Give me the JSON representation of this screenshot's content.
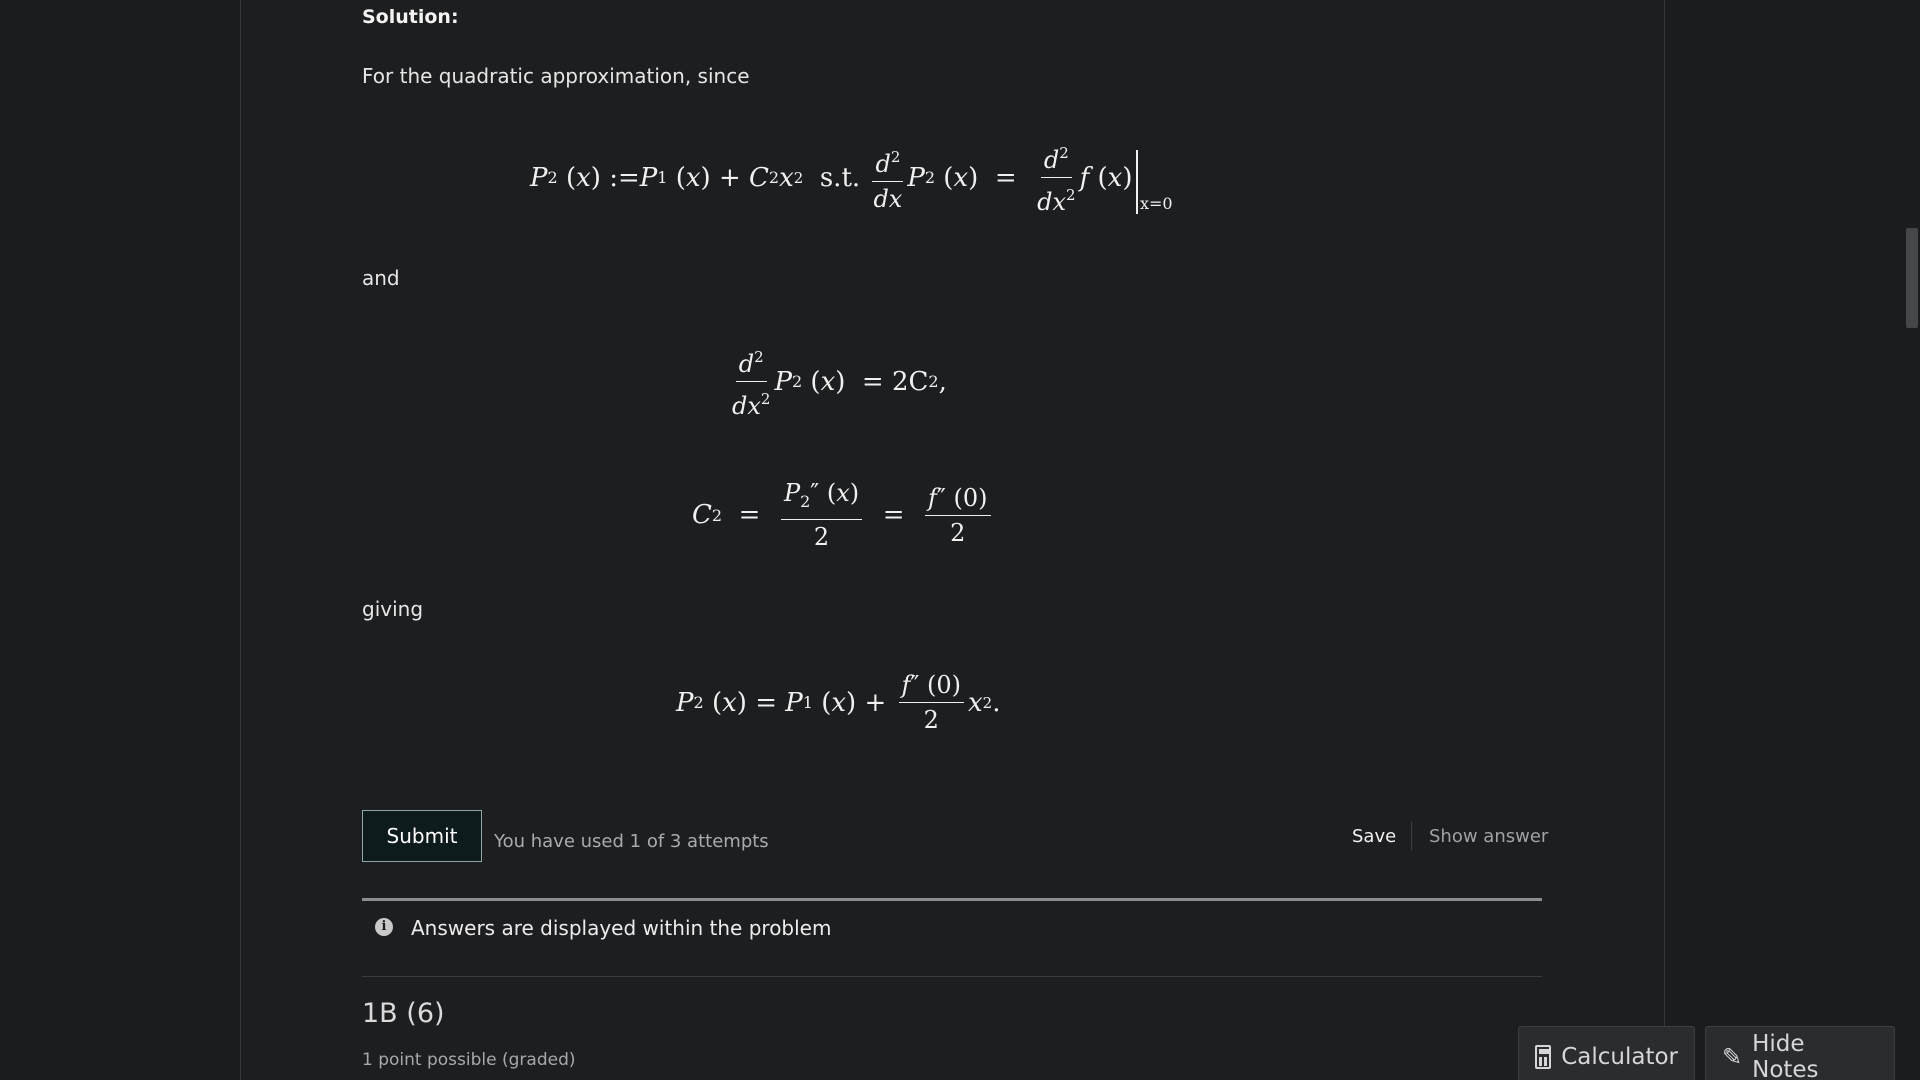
{
  "solution": {
    "heading": "Solution:",
    "intro": "For the quadratic approximation, since",
    "and_text": "and",
    "giving_text": "giving"
  },
  "math": {
    "eq1_lhs_def": ":= ",
    "eq1_st": "s.t.",
    "eq1_eval": "x=0",
    "eq2_rhs": "= 2C",
    "eq4_tail": "."
  },
  "actions": {
    "submit_label": "Submit",
    "attempts_text": "You have used 1 of 3 attempts",
    "save_label": "Save",
    "show_answer_label": "Show answer"
  },
  "notice": {
    "text": "Answers are displayed within the problem"
  },
  "next_problem": {
    "title": "1B (6)",
    "points": "1 point possible (graded)"
  },
  "floating": {
    "calculator_label": "Calculator",
    "notes_label": "Hide Notes"
  },
  "icons": {
    "info": "info-icon",
    "calculator": "calculator-icon",
    "notes": "pencil-icon"
  },
  "colors": {
    "background": "#1b1c1e",
    "submit_bg": "#0e1b1c",
    "text_muted": "#a9abae"
  }
}
